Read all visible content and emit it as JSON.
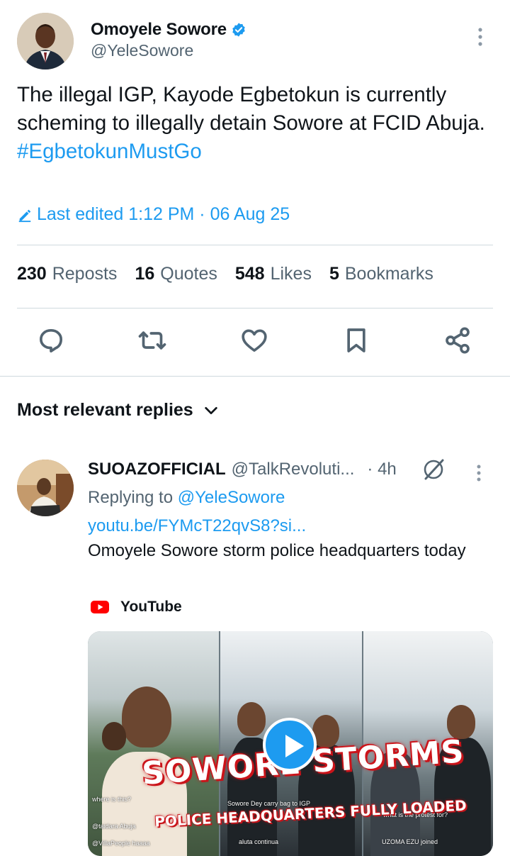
{
  "tweet": {
    "author_name": "Omoyele Sowore",
    "author_handle": "@YeleSowore",
    "text_main": "The illegal IGP, Kayode Egbetokun is currently scheming to illegally detain Sowore at FCID Abuja.",
    "hashtag": "#EgbetokunMustGo",
    "edited_label": "Last edited 1:12 PM · 06 Aug 25"
  },
  "stats": {
    "reposts_count": "230",
    "reposts_label": "Reposts",
    "quotes_count": "16",
    "quotes_label": "Quotes",
    "likes_count": "548",
    "likes_label": "Likes",
    "bookmarks_count": "5",
    "bookmarks_label": "Bookmarks"
  },
  "actions": [
    "reply-icon",
    "repost-icon",
    "like-icon",
    "bookmark-icon",
    "share-icon"
  ],
  "replies": {
    "sort_label": "Most relevant replies"
  },
  "reply": {
    "name": "SUOAZOFFICIAL",
    "handle": "@TalkRevoluti...",
    "time": "· 4h",
    "replying_prefix": "Replying to",
    "replying_handle": "@YeleSowore",
    "link": "youtu.be/FYMcT22qvS8?si...",
    "text": "Omoyele Sowore storm police headquarters today",
    "source": "YouTube",
    "thumb_title": "SOWORE STORMS",
    "thumb_subtitle": "POLICE HEADQUARTERS FULLY LOADED"
  },
  "colors": {
    "accent": "#1d9bf0",
    "text": "#0f1419",
    "muted": "#536471",
    "divider": "#cfd9de",
    "youtube_red": "#ff0000"
  }
}
